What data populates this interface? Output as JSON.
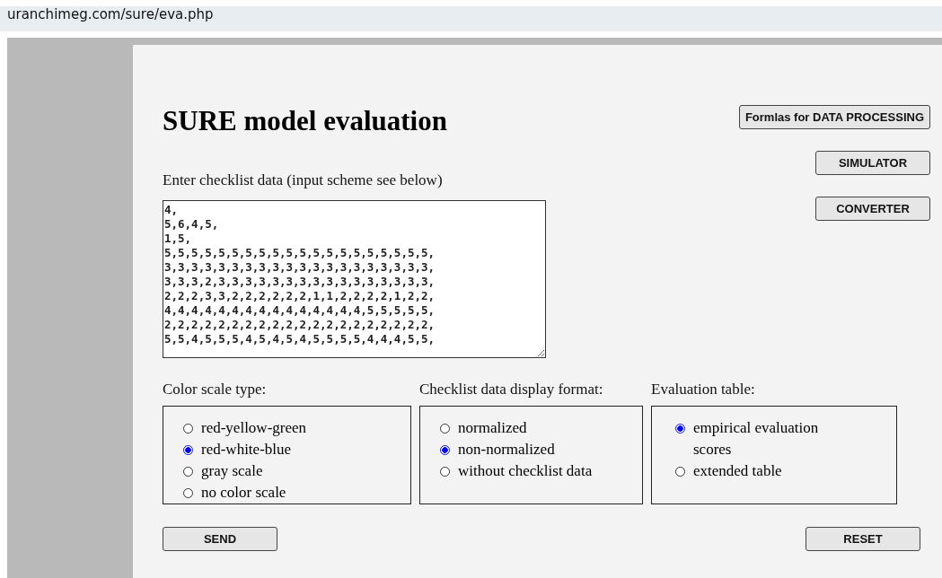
{
  "url": "uranchimeg.com/sure/eva.php",
  "title": "SURE model evaluation",
  "side_buttons": [
    "Formlas for DATA PROCESSING",
    "SIMULATOR",
    "CONVERTER"
  ],
  "checklist": {
    "label": "Enter checklist data (input scheme see below)",
    "value": "4,\n5,6,4,5,\n1,5,\n5,5,5,5,5,5,5,5,5,5,5,5,5,5,5,5,5,5,5,5,\n3,3,3,3,3,3,3,3,3,3,3,3,3,3,3,3,3,3,3,3,\n3,3,3,2,3,3,3,3,3,3,3,3,3,3,3,3,3,3,3,3,\n2,2,2,3,3,2,2,2,2,2,2,1,1,2,2,2,2,1,2,2,\n4,4,4,4,4,4,4,4,4,4,4,4,4,4,4,5,5,5,5,5,\n2,2,2,2,2,2,2,2,2,2,2,2,2,2,2,2,2,2,2,2,\n5,5,4,5,5,5,4,5,4,5,4,5,5,5,5,4,4,4,5,5,"
  },
  "groups": [
    {
      "label": "Color scale type:",
      "options": [
        {
          "label": "red-yellow-green",
          "selected": false
        },
        {
          "label": "red-white-blue",
          "selected": true
        },
        {
          "label": "gray scale",
          "selected": false
        },
        {
          "label": "no color scale",
          "selected": false
        }
      ]
    },
    {
      "label": "Checklist data display format:",
      "options": [
        {
          "label": "normalized",
          "selected": false
        },
        {
          "label": "non-normalized",
          "selected": true
        },
        {
          "label": "without checklist data",
          "selected": false
        }
      ]
    },
    {
      "label": "Evaluation table:",
      "options": [
        {
          "label": "empirical evaluation scores",
          "selected": true
        },
        {
          "label": "extended table",
          "selected": false
        }
      ]
    }
  ],
  "buttons": [
    "SEND",
    "RESET"
  ]
}
